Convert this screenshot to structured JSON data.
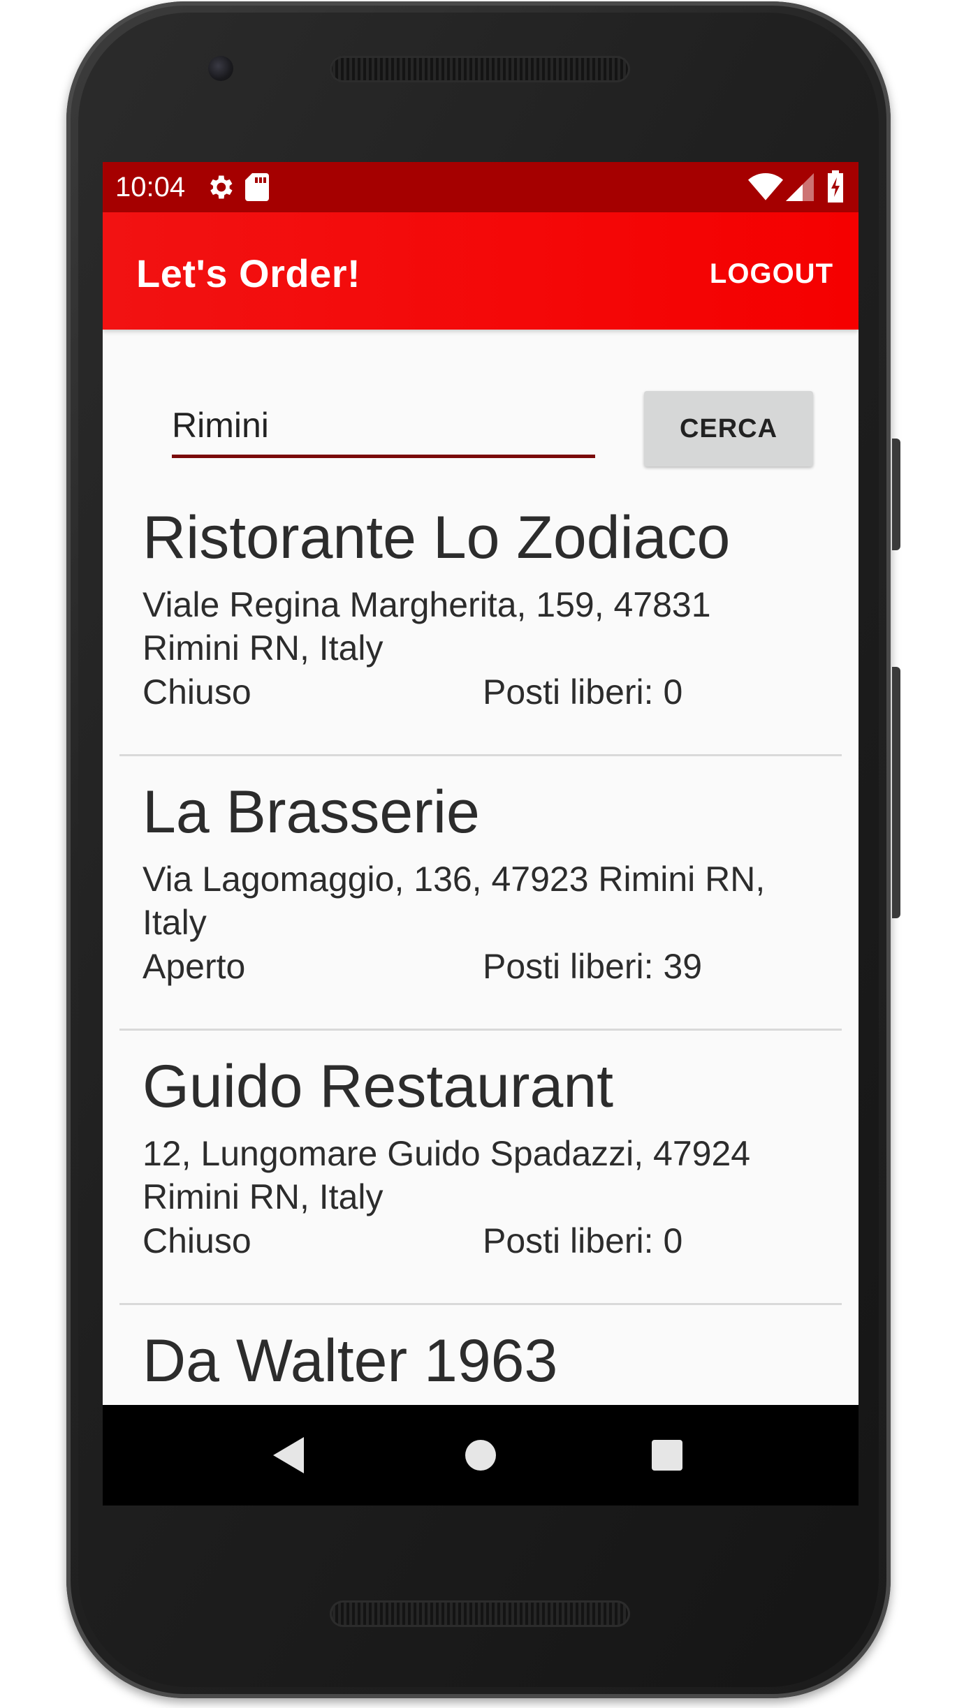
{
  "status_bar": {
    "time": "10:04",
    "icons": [
      "gear-icon",
      "sd-card-icon",
      "wifi-icon",
      "signal-icon",
      "battery-charging-icon"
    ]
  },
  "app_bar": {
    "title": "Let's Order!",
    "logout_label": "LOGOUT"
  },
  "search": {
    "value": "Rimini",
    "button_label": "CERCA"
  },
  "restaurants": [
    {
      "name": "Ristorante Lo Zodiaco",
      "address": "Viale Regina Margherita, 159, 47831 Rimini RN, Italy",
      "status": "Chiuso",
      "seats_label": "Posti liberi:",
      "seats": "0"
    },
    {
      "name": "La Brasserie",
      "address": "Via Lagomaggio, 136, 47923 Rimini RN, Italy",
      "status": "Aperto",
      "seats_label": "Posti liberi:",
      "seats": "39"
    },
    {
      "name": "Guido Restaurant",
      "address": "12, Lungomare Guido Spadazzi, 47924 Rimini RN, Italy",
      "status": "Chiuso",
      "seats_label": "Posti liberi:",
      "seats": "0"
    },
    {
      "name": "Da Walter 1963"
    }
  ],
  "nav_bar": {
    "icons": [
      "back-icon",
      "home-icon",
      "recents-icon"
    ]
  },
  "colors": {
    "status_bar": "#a50000",
    "app_bar": "#f50000",
    "accent_underline": "#7a0a0a",
    "button_bg": "#d6d7d7"
  }
}
